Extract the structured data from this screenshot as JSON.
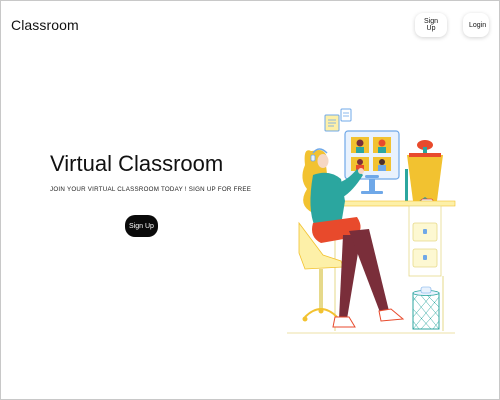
{
  "header": {
    "brand": "Classroom",
    "signup_label": "Sign Up",
    "login_label": "Login"
  },
  "hero": {
    "title": "Virtual Classroom",
    "subtitle": "JOIN YOUR VIRTUAL CLASSROOM TODAY ! SIGN UP FOR FREE",
    "cta_label": "Sign Up"
  },
  "illustration": {
    "icon": "student-at-computer-illustration",
    "accent_colors": [
      "#F2C230",
      "#2BA69F",
      "#E84A2C",
      "#7A2E3A",
      "#FDF0A8",
      "#6FA8E8"
    ]
  }
}
